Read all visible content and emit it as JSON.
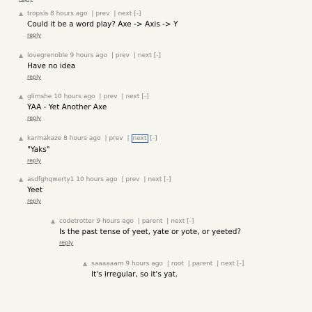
{
  "top_reply": "reply",
  "comments": [
    {
      "user": "tropsis",
      "age": "8 hours ago",
      "nav": [
        "prev",
        "next"
      ],
      "collapse": "[-]",
      "text": "Could it be a word play? Axe -> Axis -> Y",
      "reply": "reply"
    },
    {
      "user": "lovegrenoble",
      "age": "9 hours ago",
      "nav": [
        "prev",
        "next"
      ],
      "collapse": "[-]",
      "text": "Have no idea",
      "reply": "reply"
    },
    {
      "user": "glimshe",
      "age": "10 hours ago",
      "nav": [
        "prev",
        "next"
      ],
      "collapse": "[-]",
      "text": "YAA - Yet Another Axe",
      "reply": "reply"
    },
    {
      "user": "karmakaze",
      "age": "8 hours ago",
      "nav": [
        "prev",
        "next"
      ],
      "collapse": "[-]",
      "text": "\"Yaks\"",
      "reply": "reply"
    },
    {
      "user": "asdfghqwerty1",
      "age": "10 hours ago",
      "nav": [
        "prev",
        "next"
      ],
      "collapse": "[-]",
      "text": "Yeet",
      "reply": "reply"
    },
    {
      "user": "codetrotter",
      "age": "9 hours ago",
      "nav": [
        "parent",
        "next"
      ],
      "collapse": "[-]",
      "text": "Is the past tense of yeet, yate or yote, or yeeted?",
      "reply": "reply"
    },
    {
      "user": "saaaaaam",
      "age": "9 hours ago",
      "nav": [
        "root",
        "parent",
        "next"
      ],
      "collapse": "[-]",
      "text": "It's irregular, so it's yat.",
      "reply": ""
    }
  ],
  "vote_icon": "upvote-triangle-icon",
  "colors": {
    "background": "#f6f6ef",
    "meta": "#828282",
    "highlight_border": "#1a55c4"
  }
}
